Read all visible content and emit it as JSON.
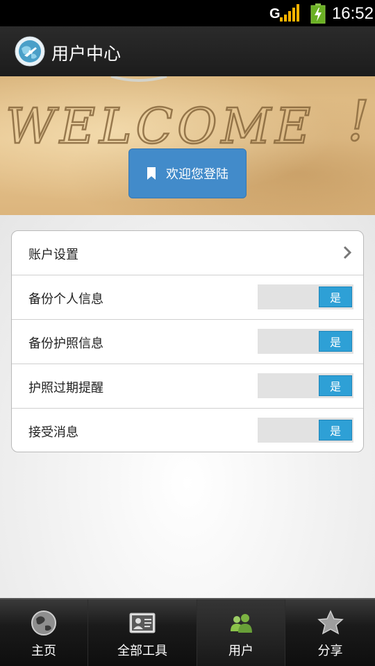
{
  "status_bar": {
    "time": "16:52",
    "signal_icon": "signal-icon",
    "battery_icon": "battery-charging-icon"
  },
  "title_bar": {
    "title": "用户中心",
    "icon": "globe-plane-icon"
  },
  "banner": {
    "image_text": "WELCOME",
    "button_label": "欢迎您登陆",
    "button_icon": "bookmark-icon"
  },
  "settings": {
    "account_label": "账户设置",
    "rows": [
      {
        "label": "备份个人信息",
        "toggle": "是",
        "on": true
      },
      {
        "label": "备份护照信息",
        "toggle": "是",
        "on": true
      },
      {
        "label": "护照过期提醒",
        "toggle": "是",
        "on": true
      },
      {
        "label": "接受消息",
        "toggle": "是",
        "on": true
      }
    ]
  },
  "bottom_nav": {
    "items": [
      {
        "label": "主页",
        "icon": "globe-icon"
      },
      {
        "label": "全部工具",
        "icon": "contact-card-icon"
      },
      {
        "label": "用户",
        "icon": "users-icon",
        "active": true
      },
      {
        "label": "分享",
        "icon": "star-icon"
      }
    ]
  },
  "colors": {
    "accent": "#428bca",
    "toggle_on": "#2ea0d6",
    "nav_bg": "#1a1a1a"
  }
}
